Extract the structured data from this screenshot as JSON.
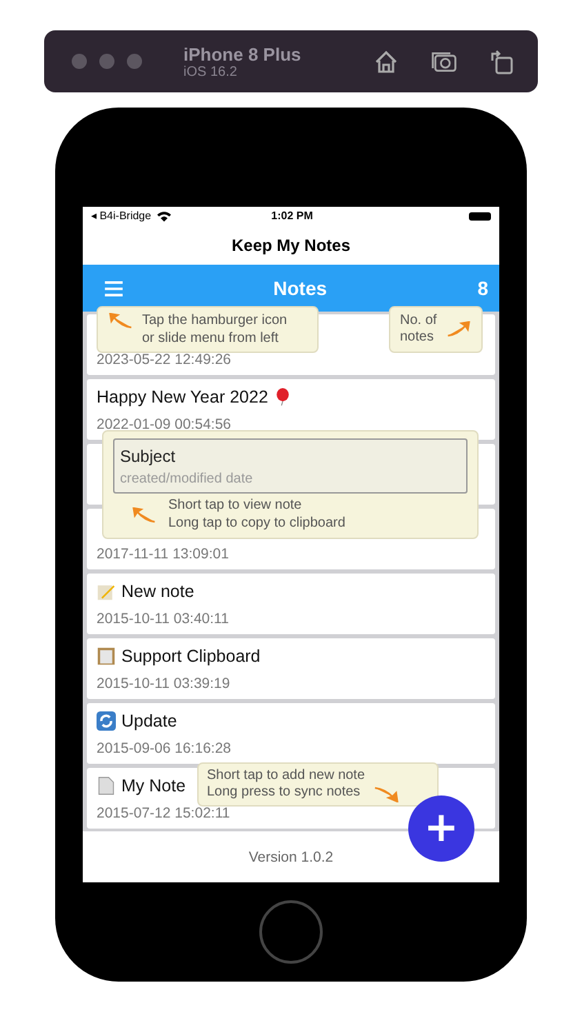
{
  "simulator": {
    "device": "iPhone 8 Plus",
    "os": "iOS 16.2"
  },
  "status_bar": {
    "carrier": "◂ B4i-Bridge",
    "time": "1:02 PM"
  },
  "app_title": "Keep My Notes",
  "header": {
    "title": "Notes",
    "count": "8"
  },
  "notes": [
    {
      "kind": "plain",
      "date": "2023-05-22 12:49:26"
    },
    {
      "kind": "balloon",
      "title": "Happy New Year 2022",
      "date": "2022-01-09 00:54:56"
    },
    {
      "kind": "plain"
    },
    {
      "kind": "plain",
      "date": "2017-11-11 13:09:01"
    },
    {
      "kind": "pencil",
      "title": "New note",
      "date": "2015-10-11 03:40:11"
    },
    {
      "kind": "clipboard",
      "title": "Support Clipboard",
      "date": "2015-10-11 03:39:19"
    },
    {
      "kind": "sync",
      "title": "Update",
      "date": "2015-09-06 16:16:28"
    },
    {
      "kind": "document",
      "title": "My Note",
      "date": "2015-07-12 15:02:11"
    }
  ],
  "tips": {
    "menu": [
      "Tap the hamburger icon",
      "or slide menu from left"
    ],
    "count": [
      "No. of",
      "notes"
    ],
    "row_subject": "Subject",
    "row_date": "created/modified date",
    "row": [
      "Short tap to view note",
      "Long tap to copy to clipboard"
    ],
    "add": [
      "Short tap to add new note",
      "Long press to sync notes"
    ]
  },
  "fab": "+",
  "version": "Version 1.0.2"
}
